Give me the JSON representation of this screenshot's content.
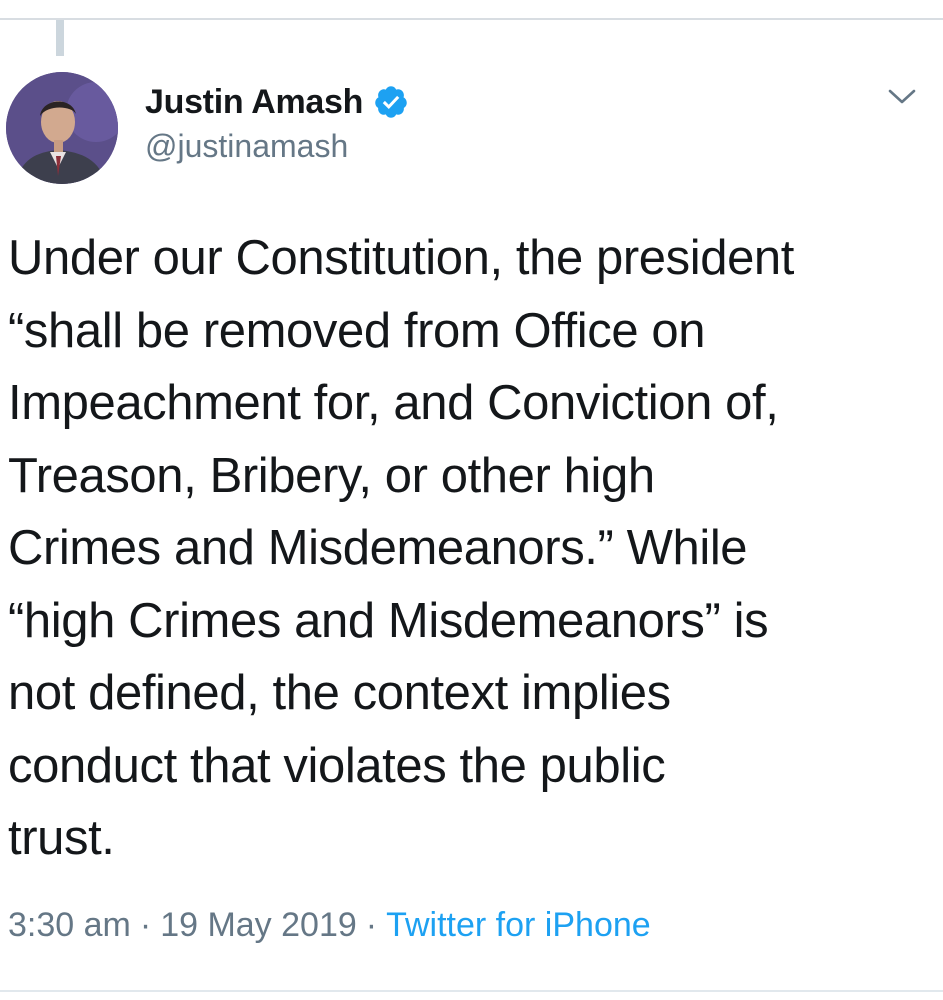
{
  "tweet": {
    "author": {
      "display_name": "Justin Amash",
      "handle": "@justinamash",
      "verified": true,
      "avatar_icon": "profile-photo"
    },
    "text_lines": [
      "Under our Constitution, the president",
      "“shall be removed from Office on",
      "Impeachment for, and Conviction of,",
      "Treason, Bribery, or other high",
      "Crimes and Misdemeanors.” While",
      "“high Crimes and Misdemeanors” is",
      "not defined, the context implies",
      "conduct that violates the public",
      "trust."
    ],
    "time": "3:30 am",
    "separator": "·",
    "date": "19 May 2019",
    "source": "Twitter for iPhone",
    "menu_icon": "chevron-down-icon"
  },
  "colors": {
    "text": "#14171a",
    "secondary": "#657786",
    "link": "#1da1f2",
    "verified": "#1da1f2"
  }
}
